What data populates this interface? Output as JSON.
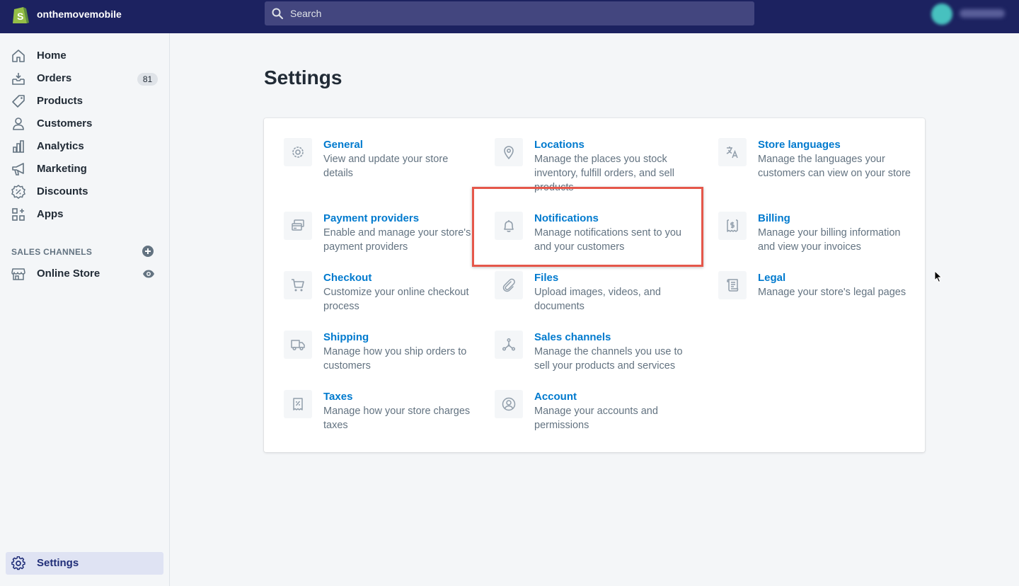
{
  "header": {
    "store_name": "onthemovemobile",
    "search_placeholder": "Search"
  },
  "sidebar": {
    "items": [
      {
        "label": "Home",
        "icon": "home-icon"
      },
      {
        "label": "Orders",
        "icon": "orders-icon",
        "badge": "81"
      },
      {
        "label": "Products",
        "icon": "tag-icon"
      },
      {
        "label": "Customers",
        "icon": "person-icon"
      },
      {
        "label": "Analytics",
        "icon": "bar-chart-icon"
      },
      {
        "label": "Marketing",
        "icon": "megaphone-icon"
      },
      {
        "label": "Discounts",
        "icon": "discount-icon"
      },
      {
        "label": "Apps",
        "icon": "apps-icon"
      }
    ],
    "sales_channels_title": "SALES CHANNELS",
    "online_store_label": "Online Store",
    "settings_label": "Settings"
  },
  "main": {
    "title": "Settings",
    "settings": [
      {
        "title": "General",
        "description": "View and update your store details",
        "icon": "gear-icon"
      },
      {
        "title": "Locations",
        "description": "Manage the places you stock inventory, fulfill orders, and sell products",
        "icon": "location-pin-icon"
      },
      {
        "title": "Store languages",
        "description": "Manage the languages your customers can view on your store",
        "icon": "translate-icon"
      },
      {
        "title": "Payment providers",
        "description": "Enable and manage your store's payment providers",
        "icon": "credit-card-icon"
      },
      {
        "title": "Notifications",
        "description": "Manage notifications sent to you and your customers",
        "icon": "bell-icon"
      },
      {
        "title": "Billing",
        "description": "Manage your billing information and view your invoices",
        "icon": "billing-icon"
      },
      {
        "title": "Checkout",
        "description": "Customize your online checkout process",
        "icon": "cart-icon"
      },
      {
        "title": "Files",
        "description": "Upload images, videos, and documents",
        "icon": "paperclip-icon"
      },
      {
        "title": "Legal",
        "description": "Manage your store's legal pages",
        "icon": "legal-document-icon"
      },
      {
        "title": "Shipping",
        "description": "Manage how you ship orders to customers",
        "icon": "truck-icon"
      },
      {
        "title": "Sales channels",
        "description": "Manage the channels you use to sell your products and services",
        "icon": "channels-icon"
      },
      {
        "title": "Taxes",
        "description": "Manage how your store charges taxes",
        "icon": "tax-receipt-icon"
      },
      {
        "title": "Account",
        "description": "Manage your accounts and permissions",
        "icon": "account-circle-icon"
      }
    ]
  },
  "colors": {
    "topbar": "#1c2260",
    "link": "#007ace",
    "highlight": "#e5574a"
  }
}
